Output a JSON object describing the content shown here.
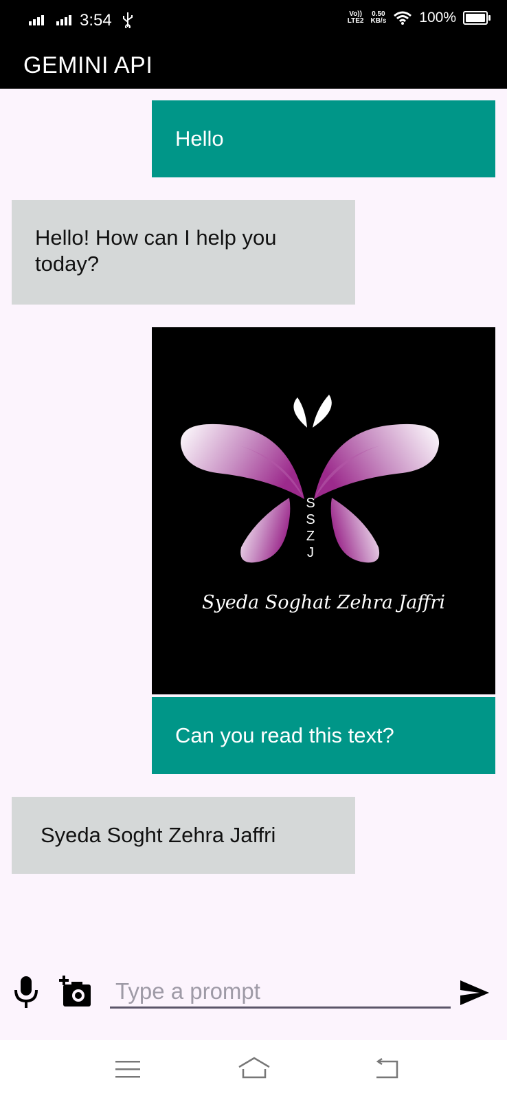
{
  "status_bar": {
    "time": "3:54",
    "network_type": "LTE2",
    "volte": "Vo))",
    "speed_value": "0.50",
    "speed_unit": "KB/s",
    "battery_percent": "100%",
    "icons": [
      "signal-icon",
      "usb-icon",
      "wifi-icon",
      "battery-icon"
    ]
  },
  "app_bar": {
    "title": "GEMINI API"
  },
  "messages": [
    {
      "role": "user",
      "type": "text",
      "text": "Hello"
    },
    {
      "role": "model",
      "type": "text",
      "text": "Hello! How can I help you today?"
    },
    {
      "role": "user",
      "type": "image",
      "caption": "Syeda Soghat Zehra Jaffri",
      "monogram": [
        "S",
        "S",
        "Z",
        "J"
      ]
    },
    {
      "role": "user",
      "type": "text",
      "text": "Can you read this text?"
    },
    {
      "role": "model",
      "type": "text",
      "text": "Syeda Soght Zehra Jaffri"
    }
  ],
  "composer": {
    "placeholder": "Type a prompt",
    "value": "",
    "icons": [
      "microphone-icon",
      "add-photo-icon",
      "send-icon"
    ]
  },
  "nav_bar": {
    "icons": [
      "menu-icon",
      "home-icon",
      "back-icon"
    ]
  },
  "colors": {
    "user_bubble": "#009688",
    "model_bubble": "#d5d8d8",
    "background": "#fcf4fd",
    "logo_purple": "#9c2a8c"
  }
}
